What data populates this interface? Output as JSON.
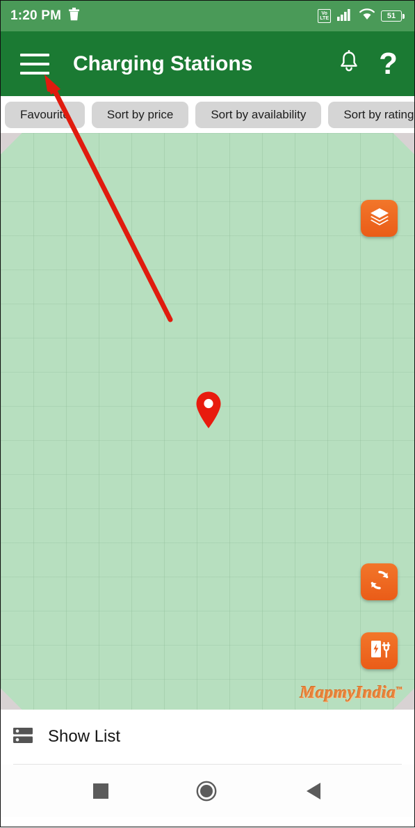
{
  "status_bar": {
    "time": "1:20 PM",
    "trash_icon": "trash-icon",
    "network_label": "Vo LTE",
    "network_line1": "Vo",
    "network_line2": "LTE",
    "signal_icon": "signal-bars-icon",
    "wifi_icon": "wifi-icon",
    "battery_level": "51",
    "background_color": "#4a9a58"
  },
  "app_bar": {
    "menu_icon": "hamburger-menu-icon",
    "title": "Charging Stations",
    "notification_icon": "bell-icon",
    "help_icon": "?",
    "background_color": "#1b7a33"
  },
  "filters": {
    "chips": [
      {
        "label": "Favourite"
      },
      {
        "label": "Sort by price"
      },
      {
        "label": "Sort by availability"
      },
      {
        "label": "Sort by rating"
      }
    ],
    "chip_color": "#d5d5d5"
  },
  "map": {
    "background_color": "#b7dfbf",
    "marker": "map-pin-marker",
    "marker_color": "#e81b0e",
    "watermark": "MapmyIndia",
    "watermark_color": "#e8833a",
    "controls": [
      {
        "name": "layers-button",
        "icon": "layers-icon"
      },
      {
        "name": "refresh-button",
        "icon": "refresh-icon"
      },
      {
        "name": "charging-station-button",
        "icon": "charging-station-icon"
      }
    ],
    "control_color": "#ea5c18"
  },
  "bottom_bar": {
    "list_icon": "list-view-icon",
    "label": "Show List"
  },
  "nav_bar": {
    "recents_icon": "square-recents-icon",
    "home_icon": "circle-home-icon",
    "back_icon": "triangle-back-icon"
  },
  "annotation": {
    "type": "arrow",
    "color": "#e01b0e",
    "points_to": "hamburger-menu-icon"
  }
}
